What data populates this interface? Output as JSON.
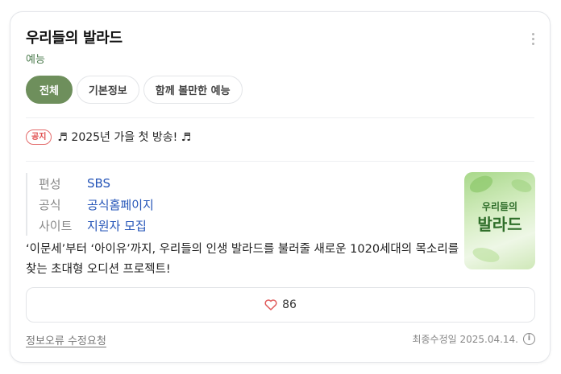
{
  "card": {
    "title": "우리들의 발라드",
    "subtitle": "예능"
  },
  "tabs": [
    {
      "label": "전체",
      "active": true
    },
    {
      "label": "기본정보",
      "active": false
    },
    {
      "label": "함께 볼만한 예능",
      "active": false
    }
  ],
  "notice": {
    "badge": "공지",
    "text": "♬ 2025년 가을 첫 방송! ♬"
  },
  "info": {
    "rows": [
      {
        "key": "편성",
        "value": "SBS"
      },
      {
        "key": "공식",
        "value": "공식홈페이지"
      },
      {
        "key": "사이트",
        "value": "지원자 모집"
      }
    ]
  },
  "poster": {
    "line1": "우리들의",
    "line2": "발라드"
  },
  "description": "‘이문세’부터 ‘아이유’까지, 우리들의 인생 발라드를 불러줄 새로운 1020세대의 목소리를 찾는 초대형 오디션 프로젝트!",
  "like": {
    "count": "86",
    "icon": "heart-outline-icon",
    "color": "#e05a5a"
  },
  "footer": {
    "report_link": "정보오류 수정요청",
    "updated_label": "최종수정일 2025.04.14.",
    "info_icon_glyph": "i"
  },
  "colors": {
    "accent": "#6e8f5c",
    "link": "#2555b8",
    "subtitle": "#4a7a4c"
  }
}
